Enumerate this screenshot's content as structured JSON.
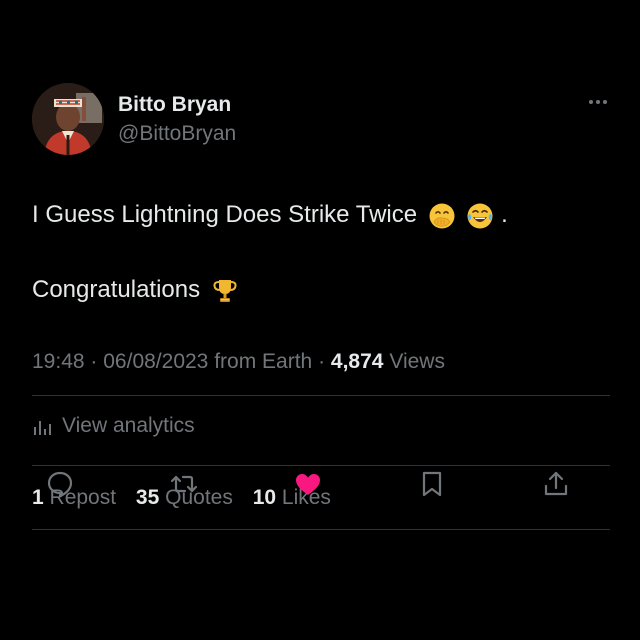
{
  "author": {
    "display_name": "Bitto Bryan",
    "handle": "@BittoBryan",
    "avatar_icon": "profile-photo"
  },
  "tweet": {
    "line1_text": "I Guess Lightning Does Strike Twice",
    "line1_emojis": [
      "face-with-hand-over-mouth",
      "face-with-tears-of-joy"
    ],
    "line1_suffix": ".",
    "line2_text": "Congratulations",
    "line2_emoji": "trophy"
  },
  "meta": {
    "time": "19:48",
    "separator": "·",
    "date": "06/08/2023",
    "source": "from Earth",
    "views_count": "4,874",
    "views_label": "Views"
  },
  "analytics": {
    "label": "View analytics",
    "icon": "bar-chart-icon"
  },
  "stats": {
    "reposts_count": "1",
    "reposts_label": "Repost",
    "quotes_count": "35",
    "quotes_label": "Quotes",
    "likes_count": "10",
    "likes_label": "Likes"
  },
  "actions": [
    "reply-icon",
    "repost-icon",
    "like-icon",
    "bookmark-icon",
    "share-icon"
  ],
  "colors": {
    "background": "#000000",
    "text_primary": "#e7e9ea",
    "text_secondary": "#71767b",
    "divider": "#2f3336",
    "like_active": "#f91880"
  }
}
